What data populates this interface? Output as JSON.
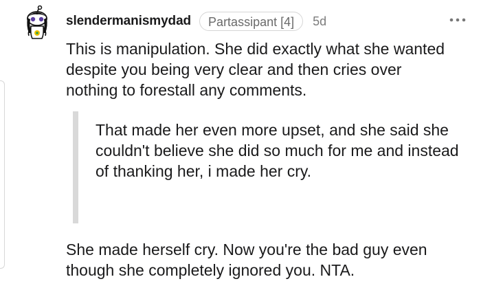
{
  "comment": {
    "username": "slendermanismydad",
    "flair": "Partassipant [4]",
    "age": "5d",
    "more_icon": "more-horizontal-icon",
    "paragraph1": "This is manipulation. She did exactly what she wanted despite you being very clear and then cries over nothing to forestall any comments.",
    "quote": "That made her even more upset, and she said she couldn't believe she did so much for me and instead of thanking her, i made her cry.",
    "paragraph2": "She made herself cry. Now you're the bad guy even though she completely ignored you. NTA."
  },
  "colors": {
    "text": "#1a1a1b",
    "meta": "#7c7c7c",
    "quote_bar": "#d9d9d9"
  }
}
